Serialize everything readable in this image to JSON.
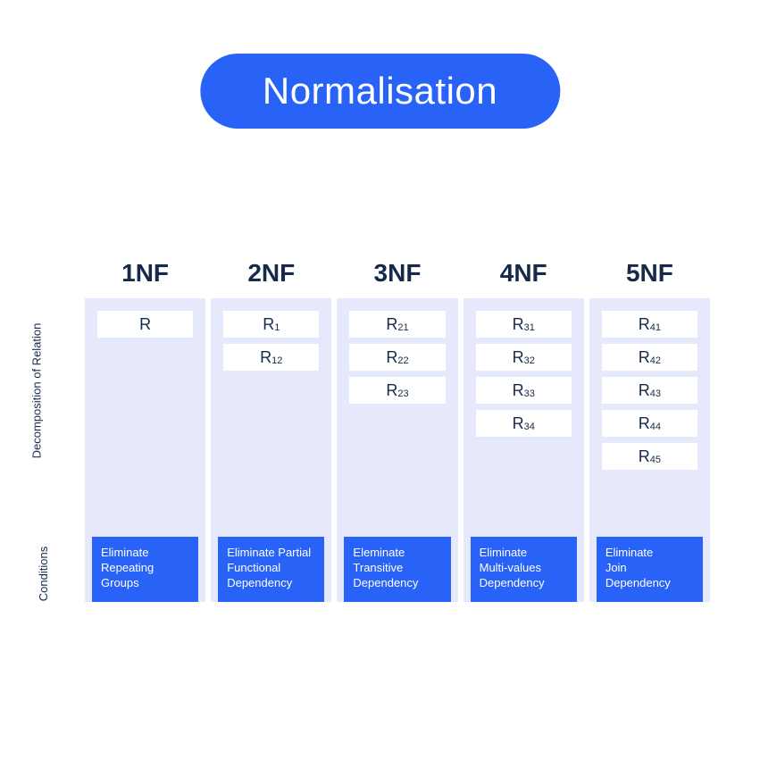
{
  "title": "Normalisation",
  "sideLabels": {
    "decomposition": "Decomposition of Relation",
    "conditions": "Conditions"
  },
  "columns": [
    {
      "header": "1NF",
      "relations": [
        {
          "base": "R",
          "sub": ""
        }
      ],
      "condition": "Eliminate\nRepeating\nGroups"
    },
    {
      "header": "2NF",
      "relations": [
        {
          "base": "R",
          "sub": "1"
        },
        {
          "base": "R",
          "sub": "12"
        }
      ],
      "condition": "Eliminate Partial\nFunctional\nDependency"
    },
    {
      "header": "3NF",
      "relations": [
        {
          "base": "R",
          "sub": "21"
        },
        {
          "base": "R",
          "sub": "22"
        },
        {
          "base": "R",
          "sub": "23"
        }
      ],
      "condition": "Eleminate\nTransitive\nDependency"
    },
    {
      "header": "4NF",
      "relations": [
        {
          "base": "R",
          "sub": "31"
        },
        {
          "base": "R",
          "sub": "32"
        },
        {
          "base": "R",
          "sub": "33"
        },
        {
          "base": "R",
          "sub": "34"
        }
      ],
      "condition": "Eliminate\nMulti-values\nDependency"
    },
    {
      "header": "5NF",
      "relations": [
        {
          "base": "R",
          "sub": "41"
        },
        {
          "base": "R",
          "sub": "42"
        },
        {
          "base": "R",
          "sub": "43"
        },
        {
          "base": "R",
          "sub": "44"
        },
        {
          "base": "R",
          "sub": "45"
        }
      ],
      "condition": "Eliminate\nJoin\nDependency"
    }
  ]
}
